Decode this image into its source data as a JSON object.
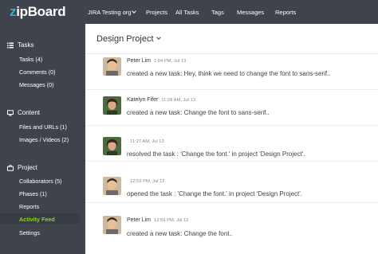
{
  "app": {
    "logo_z": "z",
    "logo_rest": "ipBoard"
  },
  "topnav": {
    "org": "JIRA Testing org",
    "items": [
      "Projects",
      "All Tasks",
      "Tags",
      "Messages",
      "Reports"
    ]
  },
  "sidebar": {
    "tasks": {
      "title": "Tasks",
      "items": [
        "Tasks (4)",
        "Comments (0)",
        "Messages (0)"
      ]
    },
    "content": {
      "title": "Content",
      "items": [
        "Files and URLs (1)",
        "Images / Videos (2)"
      ]
    },
    "project": {
      "title": "Project",
      "items": [
        "Collaborators (5)",
        "Phases (1)",
        "Reports",
        "Activity Feed",
        "Settings"
      ]
    },
    "active_item": "Activity Feed"
  },
  "main": {
    "project_title": "Design Project",
    "feed": [
      {
        "name": "Peter Lim",
        "time": "1:04 PM, Jul 13",
        "message": "created a new task: Hey, think we need to change the font to sans-serif.."
      },
      {
        "name": "Katelyn Fifer",
        "time": "11:28 AM, Jul 13",
        "message": "created a new task: Change the font to sans-serif.."
      },
      {
        "name": "",
        "time": "11:27 AM, Jul 13",
        "message": "resolved the task : 'Change the font.' in project 'Design Project'."
      },
      {
        "name": "",
        "time": "12:59 PM, Jul 12",
        "message": "opened the task : 'Change the font.' in project 'Design Project'."
      },
      {
        "name": "Peter Lim",
        "time": "12:59 PM, Jul 12",
        "message": "created a new task: Change the font.."
      }
    ]
  },
  "colors": {
    "sidebar_bg": "#3e434c",
    "accent_logo": "#2fb5c9",
    "active_green": "#8bd31f"
  }
}
